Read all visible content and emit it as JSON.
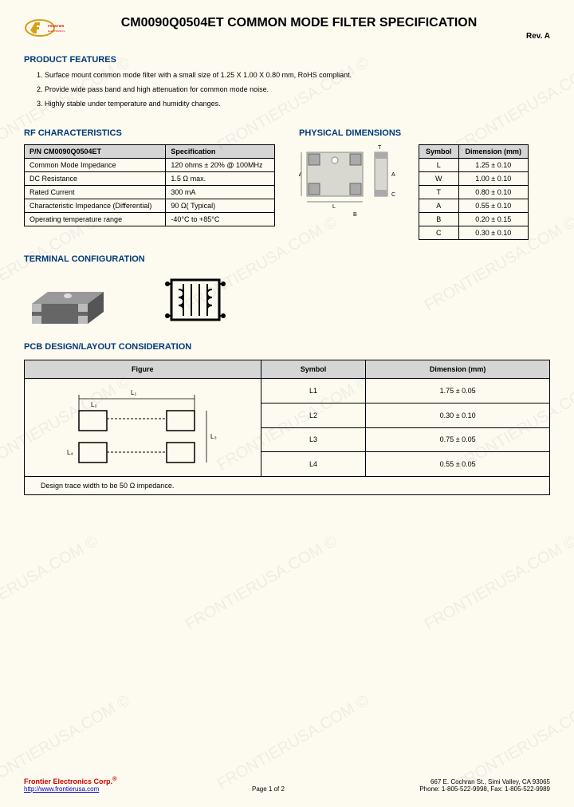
{
  "header": {
    "title": "CM0090Q0504ET COMMON MODE FILTER SPECIFICATION",
    "revision": "Rev. A",
    "logo_text": "FRONTIER ELECTRONICS"
  },
  "sections": {
    "product_features": "PRODUCT FEATURES",
    "rf_characteristics": "RF CHARACTERISTICS",
    "physical_dimensions": "PHYSICAL DIMENSIONS",
    "terminal_configuration": "TERMINAL CONFIGURATION",
    "pcb_design": "PCB DESIGN/LAYOUT CONSIDERATION"
  },
  "features": [
    "Surface mount common mode filter with a small size of 1.25 X 1.00 X 0.80 mm, RoHS compliant.",
    "Provide wide pass band and high attenuation for common mode noise.",
    "Highly stable under temperature and humidity changes."
  ],
  "rf_table": {
    "header_pn": "P/N CM0090Q0504ET",
    "header_spec": "Specification",
    "rows": [
      {
        "name": "Common Mode Impedance",
        "spec": "120 ohms ± 20% @ 100MHz"
      },
      {
        "name": "DC Resistance",
        "spec": "1.5 Ω max."
      },
      {
        "name": "Rated Current",
        "spec": "300 mA"
      },
      {
        "name": "Characteristic Impedance (Differential)",
        "spec": "90 Ω( Typical)"
      },
      {
        "name": "Operating temperature range",
        "spec": "-40°C to +85°C"
      }
    ]
  },
  "dim_table": {
    "header_symbol": "Symbol",
    "header_dim": "Dimension (mm)",
    "rows": [
      {
        "sym": "L",
        "dim": "1.25 ± 0.10"
      },
      {
        "sym": "W",
        "dim": "1.00 ± 0.10"
      },
      {
        "sym": "T",
        "dim": "0.80 ± 0.10"
      },
      {
        "sym": "A",
        "dim": "0.55 ± 0.10"
      },
      {
        "sym": "B",
        "dim": "0.20 ± 0.15"
      },
      {
        "sym": "C",
        "dim": "0.30 ± 0.10"
      }
    ]
  },
  "pcb_table": {
    "header_figure": "Figure",
    "header_symbol": "Symbol",
    "header_dim": "Dimension (mm)",
    "rows": [
      {
        "sym": "L1",
        "dim": "1.75 ± 0.05"
      },
      {
        "sym": "L2",
        "dim": "0.30 ± 0.10"
      },
      {
        "sym": "L3",
        "dim": "0.75 ± 0.05"
      },
      {
        "sym": "L4",
        "dim": "0.55 ± 0.05"
      }
    ],
    "note": "Design trace width to be 50 Ω impedance."
  },
  "footer": {
    "company": "Frontier Electronics Corp.",
    "reg": "®",
    "url": "http://www.frontierusa.com",
    "page": "Page 1 of 2",
    "address": "667 E. Cochran St., Simi Valley, CA 93065",
    "phone": "Phone: 1-805-522-9998, Fax: 1-805-522-9989"
  },
  "watermark": "FRONTIERUSA.COM ©"
}
